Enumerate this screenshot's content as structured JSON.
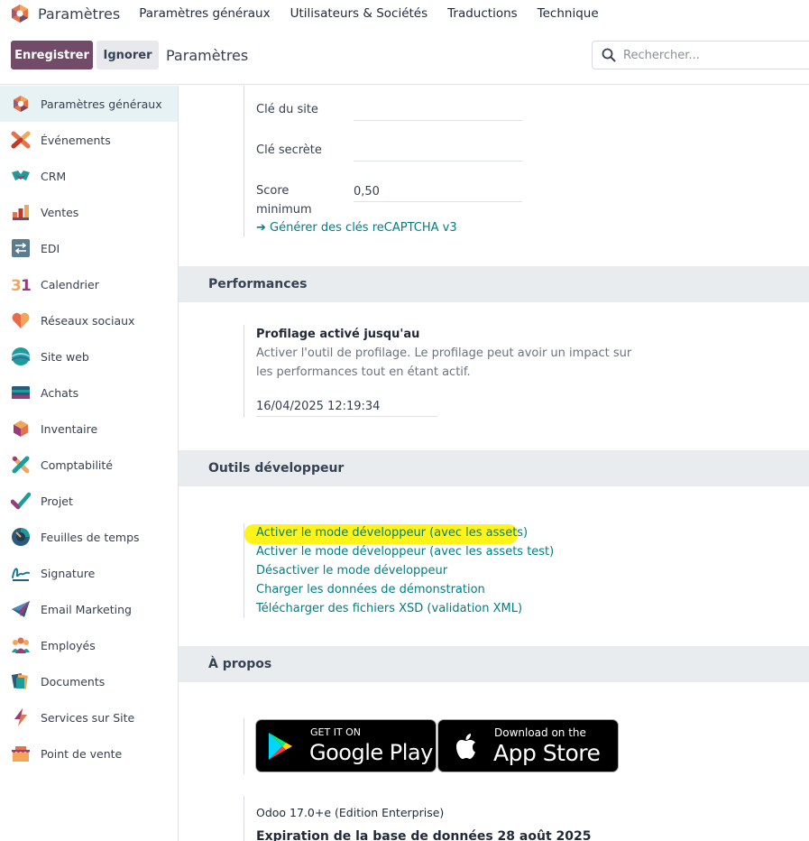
{
  "navbar": {
    "brand": "Paramètres",
    "menu": [
      "Paramètres généraux",
      "Utilisateurs & Sociétés",
      "Traductions",
      "Technique"
    ]
  },
  "controlbar": {
    "save_label": "Enregistrer",
    "discard_label": "Ignorer",
    "title": "Paramètres",
    "search_placeholder": "Rechercher..."
  },
  "sidebar": {
    "items": [
      {
        "label": "Paramètres généraux",
        "icon": "odoo-settings-icon"
      },
      {
        "label": "Événements",
        "icon": "events-icon"
      },
      {
        "label": "CRM",
        "icon": "crm-icon"
      },
      {
        "label": "Ventes",
        "icon": "sales-icon"
      },
      {
        "label": "EDI",
        "icon": "edi-icon"
      },
      {
        "label": "Calendrier",
        "icon": "calendar-icon"
      },
      {
        "label": "Réseaux sociaux",
        "icon": "social-icon"
      },
      {
        "label": "Site web",
        "icon": "website-icon"
      },
      {
        "label": "Achats",
        "icon": "purchase-icon"
      },
      {
        "label": "Inventaire",
        "icon": "inventory-icon"
      },
      {
        "label": "Comptabilité",
        "icon": "accounting-icon"
      },
      {
        "label": "Projet",
        "icon": "project-icon"
      },
      {
        "label": "Feuilles de temps",
        "icon": "timesheet-icon"
      },
      {
        "label": "Signature",
        "icon": "sign-icon"
      },
      {
        "label": "Email Marketing",
        "icon": "email-marketing-icon"
      },
      {
        "label": "Employés",
        "icon": "employees-icon"
      },
      {
        "label": "Documents",
        "icon": "documents-icon"
      },
      {
        "label": "Services sur Site",
        "icon": "field-service-icon"
      },
      {
        "label": "Point de vente",
        "icon": "pos-icon"
      }
    ]
  },
  "recaptcha": {
    "site_key_label": "Clé du site",
    "secret_key_label": "Clé secrète",
    "score_label_1": "Score",
    "score_label_2": "minimum",
    "score_value": "0,50",
    "generate_link": "Générer des clés reCAPTCHA v3"
  },
  "performance": {
    "header": "Performances",
    "title": "Profilage activé jusqu'au",
    "desc_1": "Activer l'outil de profilage. Le profilage peut avoir un impact sur",
    "desc_2": "les performances tout en étant actif.",
    "value": "16/04/2025 12:19:34"
  },
  "dev_tools": {
    "header": "Outils développeur",
    "links": [
      "Activer le mode développeur (avec les assets)",
      "Activer le mode développeur (avec les assets test)",
      "Désactiver le mode développeur",
      "Charger les données de démonstration",
      "Télécharger des fichiers XSD (validation XML)"
    ]
  },
  "about": {
    "header": "À propos",
    "google_small": "GET IT ON",
    "google_big": "Google Play",
    "apple_small": "Download on the",
    "apple_big": "App Store",
    "version": "Odoo 17.0+e (Edition Enterprise)",
    "expiration": "Expiration de la base de données 28 août 2025"
  },
  "colors": {
    "primary": "#714b67",
    "link": "#017e84",
    "section_bg": "#e9ecef",
    "active_item_bg": "#e6f2f3",
    "highlight": "#fff200"
  }
}
